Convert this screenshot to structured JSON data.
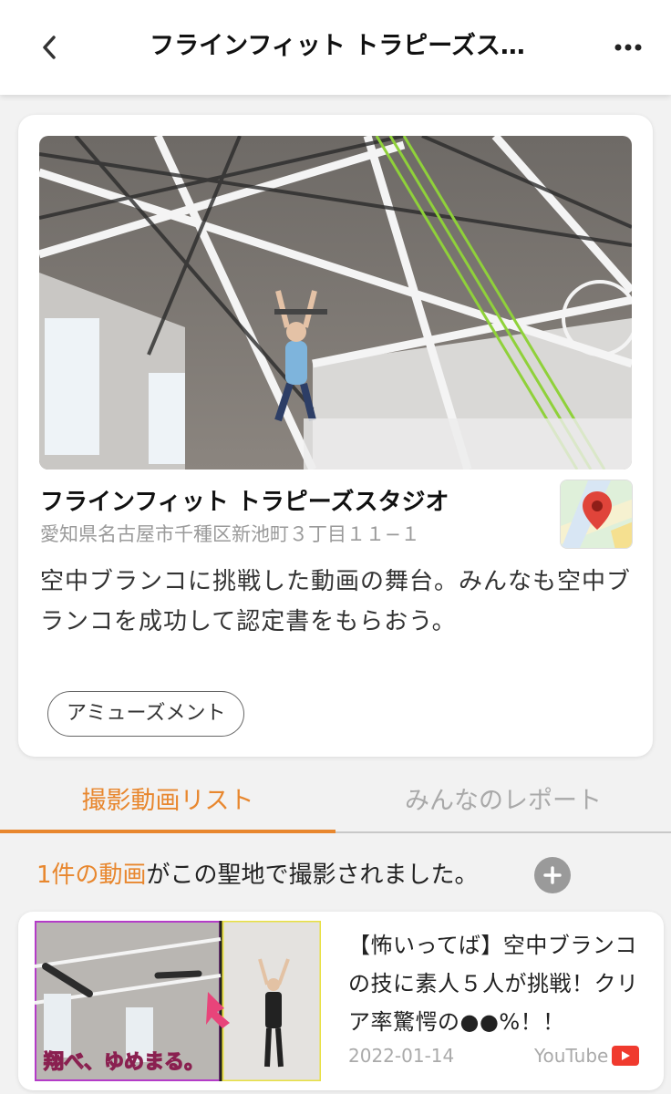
{
  "header": {
    "title": "フラインフィット トラピーズス…"
  },
  "spot": {
    "name": "フラインフィット トラピーズスタジオ",
    "address": "愛知県名古屋市千種区新池町３丁目１１−１",
    "description": "空中ブランコに挑戦した動画の舞台。みんなも空中ブランコを成功して認定書をもらおう。",
    "tag": "アミューズメント"
  },
  "tabs": {
    "video_list": "撮影動画リスト",
    "reports": "みんなのレポート"
  },
  "count_line": {
    "highlight": "1件の動画",
    "rest": "がこの聖地で撮影されました。"
  },
  "video": {
    "title": "【怖いってば】空中ブランコの技に素人５人が挑戦！クリア率驚愕の●●%！！",
    "date": "2022-01-14",
    "source": "YouTube",
    "thumb_caption": "翔べ、ゆめまる。"
  },
  "colors": {
    "accent": "#e8872e",
    "youtube": "#f03a2e"
  }
}
